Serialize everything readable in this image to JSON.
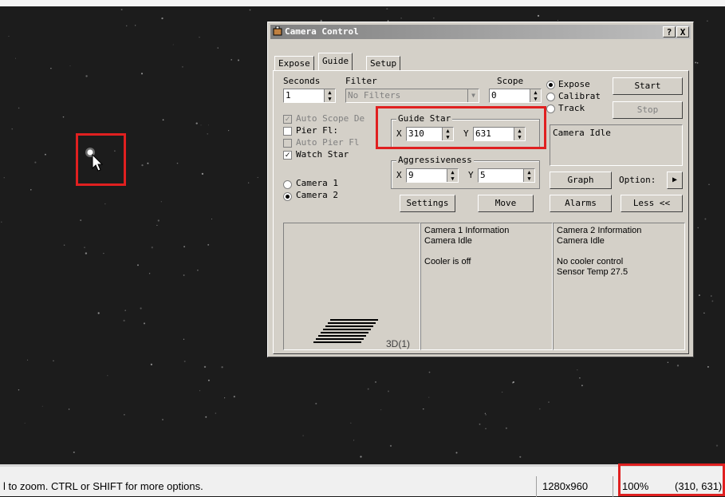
{
  "window": {
    "title": "Camera Control",
    "help_button": "?",
    "close_button": "X"
  },
  "tabs": [
    "Expose",
    "Guide",
    "Setup"
  ],
  "active_tab": "Guide",
  "guide": {
    "seconds_label": "Seconds",
    "seconds_value": "1",
    "filter_label": "Filter",
    "filter_value": "No Filters",
    "scope_label": "Scope",
    "scope_value": "0",
    "auto_scope_label": "Auto Scope De",
    "pier_flip_label": "Pier Fl:",
    "auto_pier_flip_label": "Auto Pier Fl",
    "watch_star_label": "Watch Star",
    "guide_star_title": "Guide Star",
    "guide_star_x_label": "X",
    "guide_star_x": "310",
    "guide_star_y_label": "Y",
    "guide_star_y": "631",
    "aggressiveness_title": "Aggressiveness",
    "aggr_x_label": "X",
    "aggr_x": "9",
    "aggr_y_label": "Y",
    "aggr_y": "5",
    "camera1_label": "Camera 1",
    "camera2_label": "Camera 2",
    "settings_button": "Settings",
    "move_button": "Move",
    "mode_expose": "Expose",
    "mode_calibrate": "Calibrat",
    "mode_track": "Track",
    "start_button": "Start",
    "stop_button": "Stop",
    "status_text": "Camera Idle",
    "graph_button": "Graph",
    "options_button": "Option:",
    "alarms_button": "Alarms",
    "less_button": "Less <<",
    "graph_label": "3D(1)"
  },
  "camera1_info": [
    "Camera 1 Information",
    "Camera Idle",
    "",
    "Cooler is off"
  ],
  "camera2_info": [
    "Camera 2 Information",
    "Camera Idle",
    "",
    "No cooler control",
    "Sensor Temp 27.5"
  ],
  "statusbar": {
    "hint": "l to zoom. CTRL or SHIFT for more options.",
    "image_size": "1280x960",
    "zoom": "100%",
    "coords": "(310, 631)"
  },
  "colors": {
    "highlight": "#e02020",
    "sky": "#1a1a1a",
    "window_face": "#d4d0c8"
  }
}
